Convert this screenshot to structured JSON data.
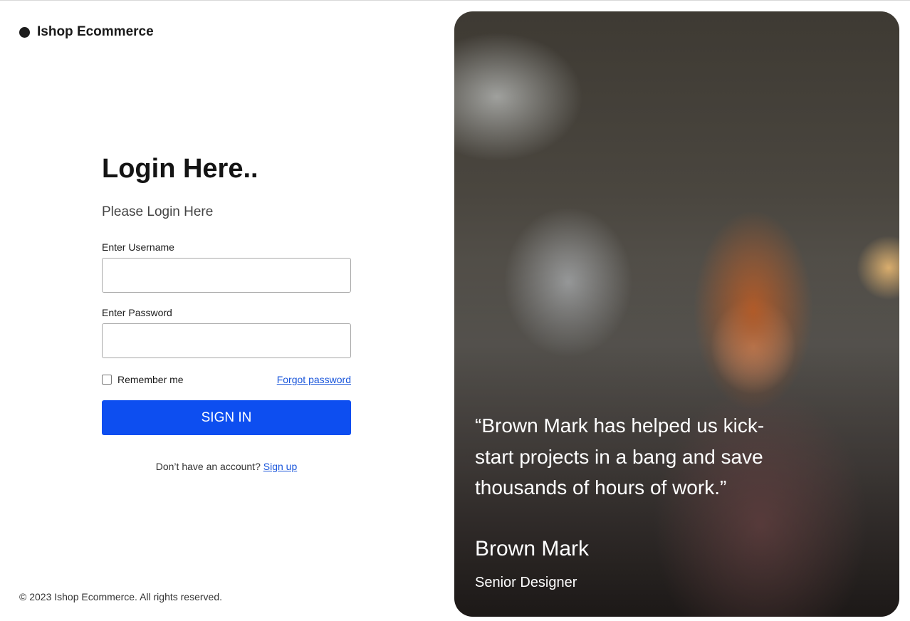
{
  "brand": {
    "name": "Ishop Ecommerce"
  },
  "login": {
    "title": "Login Here..",
    "subtitle": "Please Login Here",
    "username_label": "Enter Username",
    "username_value": "",
    "password_label": "Enter Password",
    "password_value": "",
    "remember_label": "Remember me",
    "remember_checked": false,
    "forgot_label": "Forgot password",
    "signin_label": "SIGN IN",
    "no_account_text": "Don’t have an account?",
    "signup_label": "Sign up"
  },
  "footer": {
    "copyright": "© 2023 Ishop Ecommerce. All rights reserved."
  },
  "testimonial": {
    "quote": "“Brown Mark has helped us kick-start projects in a bang and save thousands of hours of work.”",
    "author": "Brown Mark",
    "role": "Senior Designer"
  },
  "colors": {
    "accent": "#0d4ef0",
    "link": "#1a56db"
  },
  "icons": {
    "brand": "brand-dot-icon"
  }
}
